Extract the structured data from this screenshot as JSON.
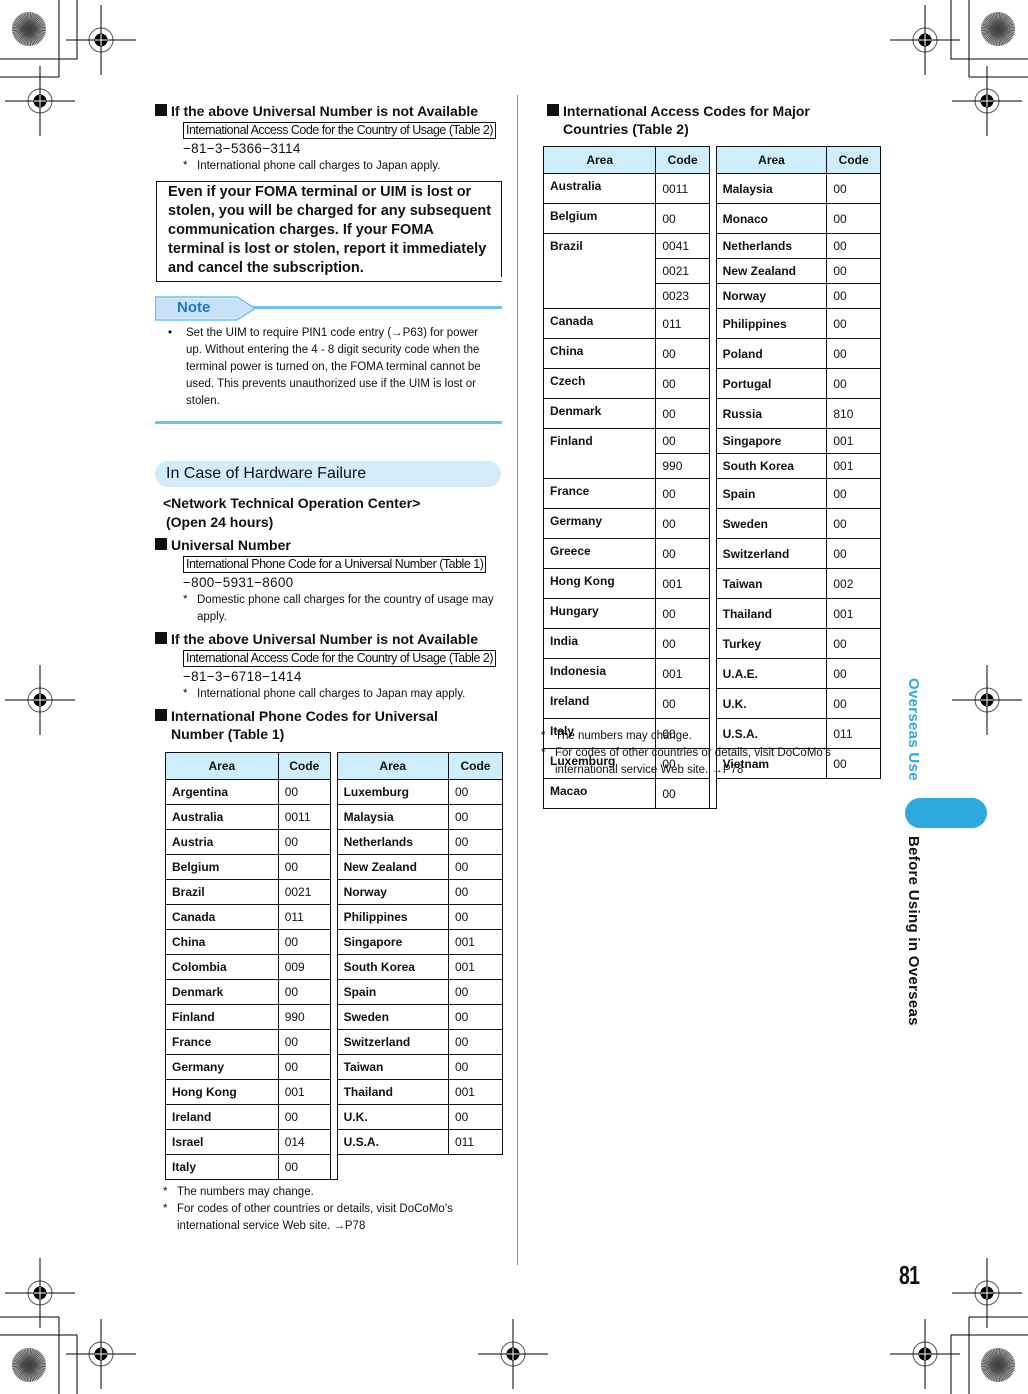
{
  "left_column": {
    "block1": {
      "heading": "If the above Universal Number is not Available",
      "box_label": "International Access Code for the Country of Usage (Table 2)",
      "number": "−81−3−5366−3114",
      "footnote": "International phone call charges to Japan apply."
    },
    "warning": "Even if your FOMA terminal or UIM is lost or stolen, you will be charged for any subsequent communication charges. If your FOMA terminal is lost or stolen, report it immediately and cancel the subscription.",
    "note": {
      "label": "Note",
      "bullet": "•",
      "text": "Set the UIM to require PIN1 code entry (→P63) for power up. Without entering the 4 - 8 digit security code when the terminal power is turned on, the FOMA terminal cannot be used. This prevents unauthorized use if the UIM is lost or stolen."
    },
    "section_title": "In Case of Hardware Failure",
    "center_name": "<Network Technical Operation Center>",
    "center_hours": "(Open 24 hours)",
    "block2": {
      "heading": "Universal Number",
      "box_label": "International Phone Code for a Universal Number (Table 1)",
      "number": "−800−5931−8600",
      "footnote": "Domestic phone call charges for the country of usage may apply."
    },
    "block3": {
      "heading": "If the above Universal Number is not Available",
      "box_label": "International Access Code for the Country of Usage (Table 2)",
      "number": "−81−3−6718−1414",
      "footnote": "International phone call charges to Japan may apply."
    },
    "table1": {
      "heading": "International Phone Codes for Universal Number (Table 1)",
      "col_area": "Area",
      "col_code": "Code",
      "left": [
        [
          "Argentina",
          "00"
        ],
        [
          "Australia",
          "0011"
        ],
        [
          "Austria",
          "00"
        ],
        [
          "Belgium",
          "00"
        ],
        [
          "Brazil",
          "0021"
        ],
        [
          "Canada",
          "011"
        ],
        [
          "China",
          "00"
        ],
        [
          "Colombia",
          "009"
        ],
        [
          "Denmark",
          "00"
        ],
        [
          "Finland",
          "990"
        ],
        [
          "France",
          "00"
        ],
        [
          "Germany",
          "00"
        ],
        [
          "Hong Kong",
          "001"
        ],
        [
          "Ireland",
          "00"
        ],
        [
          "Israel",
          "014"
        ],
        [
          "Italy",
          "00"
        ]
      ],
      "right": [
        [
          "Luxemburg",
          "00"
        ],
        [
          "Malaysia",
          "00"
        ],
        [
          "Netherlands",
          "00"
        ],
        [
          "New Zealand",
          "00"
        ],
        [
          "Norway",
          "00"
        ],
        [
          "Philippines",
          "00"
        ],
        [
          "Singapore",
          "001"
        ],
        [
          "South Korea",
          "001"
        ],
        [
          "Spain",
          "00"
        ],
        [
          "Sweden",
          "00"
        ],
        [
          "Switzerland",
          "00"
        ],
        [
          "Taiwan",
          "00"
        ],
        [
          "Thailand",
          "001"
        ],
        [
          "U.K.",
          "00"
        ],
        [
          "U.S.A.",
          "011"
        ]
      ],
      "footnotes": [
        "The numbers may change.",
        "For codes of other countries or details, visit DoCoMo’s international service Web site. →P78"
      ]
    }
  },
  "right_column": {
    "table2": {
      "heading": "International Access Codes for Major Countries (Table 2)",
      "col_area": "Area",
      "col_code": "Code",
      "left": [
        {
          "area": "Australia",
          "codes": [
            "0011"
          ]
        },
        {
          "area": "Belgium",
          "codes": [
            "00"
          ]
        },
        {
          "area": "Brazil",
          "codes": [
            "0041",
            "0021",
            "0023"
          ]
        },
        {
          "area": "Canada",
          "codes": [
            "011"
          ]
        },
        {
          "area": "China",
          "codes": [
            "00"
          ]
        },
        {
          "area": "Czech",
          "codes": [
            "00"
          ]
        },
        {
          "area": "Denmark",
          "codes": [
            "00"
          ]
        },
        {
          "area": "Finland",
          "codes": [
            "00",
            "990"
          ]
        },
        {
          "area": "France",
          "codes": [
            "00"
          ]
        },
        {
          "area": "Germany",
          "codes": [
            "00"
          ]
        },
        {
          "area": "Greece",
          "codes": [
            "00"
          ]
        },
        {
          "area": "Hong Kong",
          "codes": [
            "001"
          ]
        },
        {
          "area": "Hungary",
          "codes": [
            "00"
          ]
        },
        {
          "area": "India",
          "codes": [
            "00"
          ]
        },
        {
          "area": "Indonesia",
          "codes": [
            "001"
          ]
        },
        {
          "area": "Ireland",
          "codes": [
            "00"
          ]
        },
        {
          "area": "Italy",
          "codes": [
            "00"
          ]
        },
        {
          "area": "Luxemburg",
          "codes": [
            "00"
          ]
        },
        {
          "area": "Macao",
          "codes": [
            "00"
          ]
        }
      ],
      "right": [
        [
          "Malaysia",
          "00"
        ],
        [
          "Monaco",
          "00"
        ],
        [
          "Netherlands",
          "00"
        ],
        [
          "New Zealand",
          "00"
        ],
        [
          "Norway",
          "00"
        ],
        [
          "Philippines",
          "00"
        ],
        [
          "Poland",
          "00"
        ],
        [
          "Portugal",
          "00"
        ],
        [
          "Russia",
          "810"
        ],
        [
          "Singapore",
          "001"
        ],
        [
          "South Korea",
          "001"
        ],
        [
          "Spain",
          "00"
        ],
        [
          "Sweden",
          "00"
        ],
        [
          "Switzerland",
          "00"
        ],
        [
          "Taiwan",
          "002"
        ],
        [
          "Thailand",
          "001"
        ],
        [
          "Turkey",
          "00"
        ],
        [
          "U.A.E.",
          "00"
        ],
        [
          "U.K.",
          "00"
        ],
        [
          "U.S.A.",
          "011"
        ],
        [
          "Vietnam",
          "00"
        ]
      ],
      "footnotes": [
        "The numbers may change.",
        "For codes of other countries or details, visit DoCoMo’s international service Web site. →P78"
      ]
    }
  },
  "side": {
    "section_label": "Overseas Use",
    "chapter_label": "Before Using in Overseas",
    "accent": "#2fa8e0"
  },
  "page_number": "81",
  "footnote_star": "*"
}
